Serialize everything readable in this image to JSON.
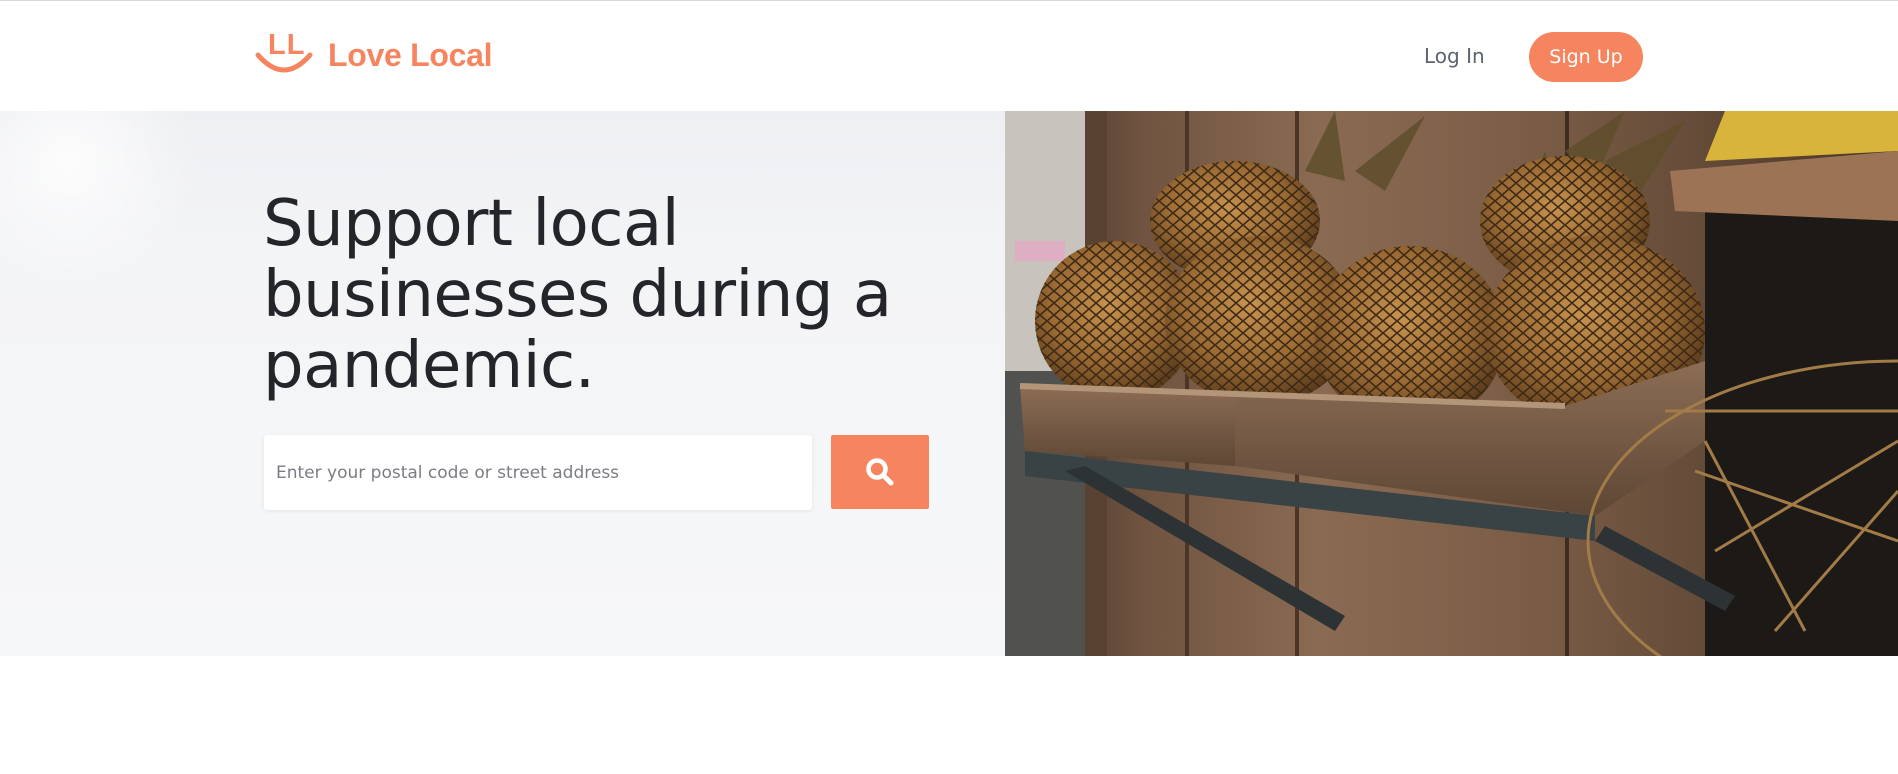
{
  "header": {
    "logo_mark": "LL",
    "logo_text": "Love Local",
    "login_label": "Log In",
    "signup_label": "Sign Up"
  },
  "hero": {
    "headline": "Support local businesses during a pandemic.",
    "search": {
      "placeholder": "Enter your postal code or street address",
      "value": "",
      "button_icon": "search-icon"
    }
  },
  "colors": {
    "brand": "#f6855f",
    "headline": "#23252a",
    "hero_bg": "#f5f6f8"
  }
}
